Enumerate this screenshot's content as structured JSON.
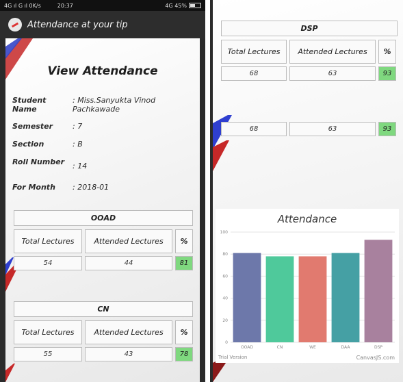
{
  "status_bar": {
    "signal": "4G ıl G ıl 0K/s",
    "time": "20:37",
    "battery": "4G 45%"
  },
  "app": {
    "title": "Attendance at your tip"
  },
  "view": {
    "heading": "View Attendance",
    "fields": [
      {
        "label": "Student Name",
        "value": ": Miss.Sanyukta Vinod Pachkawade"
      },
      {
        "label": "Semester",
        "value": ": 7"
      },
      {
        "label": "Section",
        "value": ": B"
      },
      {
        "label": "Roll Number",
        "value": ": 14"
      },
      {
        "label": "For Month",
        "value": ": 2018-01"
      }
    ]
  },
  "table_headers": {
    "total": "Total Lectures",
    "attended": "Attended Lectures",
    "percent": "%"
  },
  "subjects_left": [
    {
      "name": "OOAD",
      "total": "54",
      "attended": "44",
      "percent": "81"
    },
    {
      "name": "CN",
      "total": "55",
      "attended": "43",
      "percent": "78"
    }
  ],
  "subjects_right": {
    "name": "DSP",
    "rows": [
      {
        "total": "68",
        "attended": "63",
        "percent": "93"
      },
      {
        "total": "68",
        "attended": "63",
        "percent": "93"
      }
    ]
  },
  "colors": {
    "percent_bg": "#7fd87f",
    "appbar": "#2d2d2d"
  },
  "chart_footer": {
    "trial": "Trial Version",
    "credit": "CanvasJS.com"
  },
  "chart_data": {
    "type": "bar",
    "title": "Attendance",
    "categories": [
      "OOAD",
      "CN",
      "WE",
      "DAA",
      "DSP"
    ],
    "values": [
      81,
      78,
      78,
      81,
      93
    ],
    "colors": [
      "#6d78aa",
      "#4fc99b",
      "#e17a6f",
      "#45a0a4",
      "#a8819e"
    ],
    "ylim": [
      0,
      100
    ],
    "yticks": [
      0,
      20,
      40,
      60,
      80,
      100
    ],
    "grid": true,
    "xlabel": "",
    "ylabel": ""
  }
}
